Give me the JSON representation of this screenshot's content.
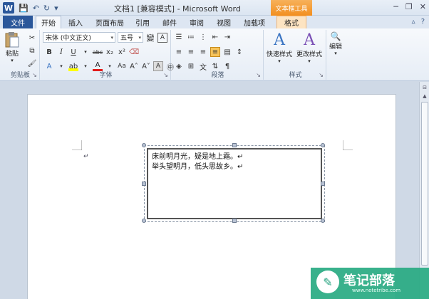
{
  "title_bar": {
    "title": "文档1 [兼容模式] - Microsoft Word",
    "contextual_tab_title": "文本框工具",
    "qat": {
      "save": "save",
      "undo": "undo",
      "redo": "redo",
      "customize": "customize"
    },
    "window_controls": {
      "minimize": "─",
      "restore": "❐",
      "close": "✕"
    }
  },
  "tabs": {
    "file": "文件",
    "home": "开始",
    "insert": "插入",
    "page_layout": "页面布局",
    "references": "引用",
    "mailings": "邮件",
    "review": "审阅",
    "view": "视图",
    "addins": "加载项",
    "format": "格式"
  },
  "ribbon": {
    "clipboard": {
      "label": "剪贴板",
      "paste": "粘贴"
    },
    "font": {
      "label": "字体",
      "font_name": "宋体 (中文正文)",
      "font_size": "五号",
      "wen": "變",
      "a_box": "A"
    },
    "paragraph": {
      "label": "段落"
    },
    "styles": {
      "label": "样式",
      "quick_styles": "快速样式",
      "change_styles": "更改样式"
    },
    "editing": {
      "label": "编辑"
    }
  },
  "document": {
    "textbox_lines": [
      "床前明月光，疑是地上霜。↵",
      "举头望明月，低头思故乡。↵"
    ],
    "para_mark": "↵"
  },
  "watermark": {
    "text": "笔记部落",
    "url": "www.notetribe.com"
  },
  "colors": {
    "file_tab": "#2b579a",
    "contextual": "#f28f1f",
    "watermark": "#28aa82"
  }
}
